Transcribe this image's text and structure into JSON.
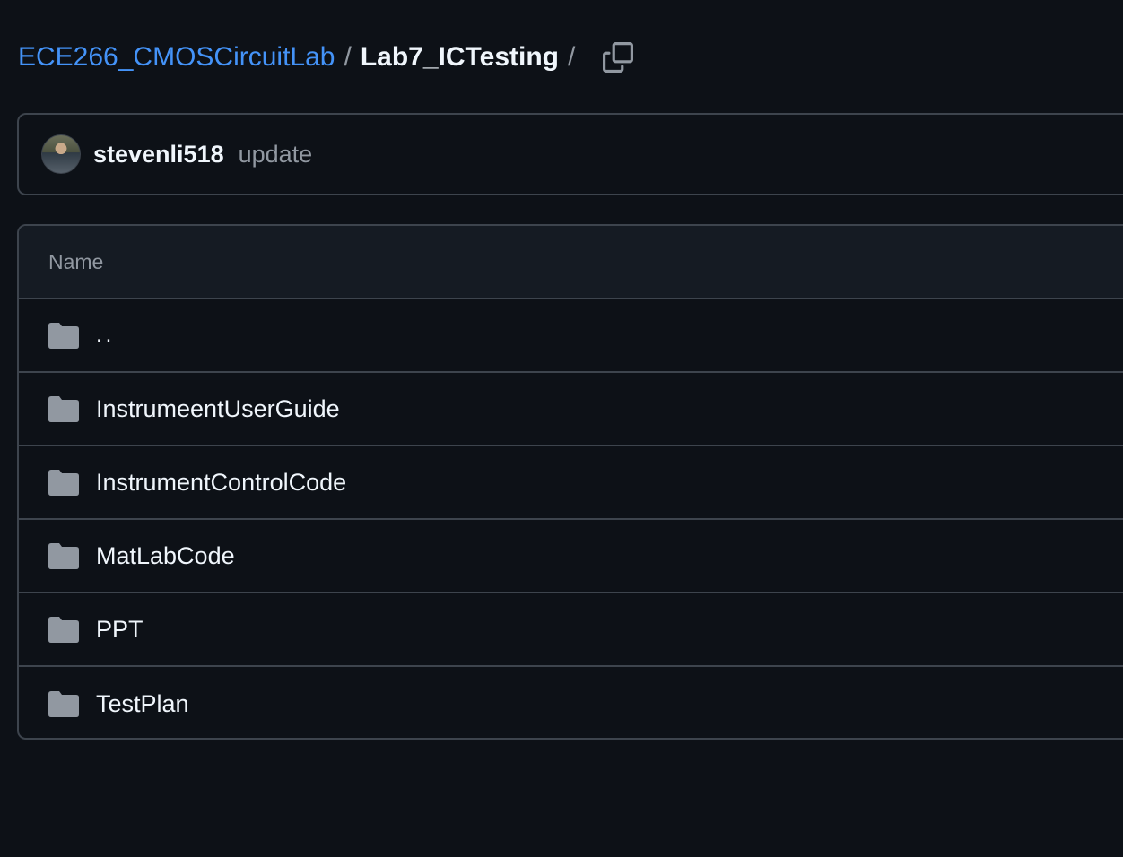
{
  "breadcrumb": {
    "repo": "ECE266_CMOSCircuitLab",
    "separator": "/",
    "current": "Lab7_ICTesting",
    "trailing_separator": "/",
    "copy_icon": "copy-icon"
  },
  "commit": {
    "author": "stevenli518",
    "message": "update"
  },
  "table": {
    "header": "Name",
    "rows": [
      {
        "label": "..",
        "icon": "folder-icon"
      },
      {
        "label": "InstrumeentUserGuide",
        "icon": "folder-icon"
      },
      {
        "label": "InstrumentControlCode",
        "icon": "folder-icon"
      },
      {
        "label": "MatLabCode",
        "icon": "folder-icon"
      },
      {
        "label": "PPT",
        "icon": "folder-icon"
      },
      {
        "label": "TestPlan",
        "icon": "folder-icon"
      }
    ]
  },
  "colors": {
    "background": "#0d1117",
    "link": "#4493f8",
    "border": "#3d444d",
    "header_bg": "#151b23",
    "muted_text": "#9198a1",
    "folder": "#9198a1"
  }
}
